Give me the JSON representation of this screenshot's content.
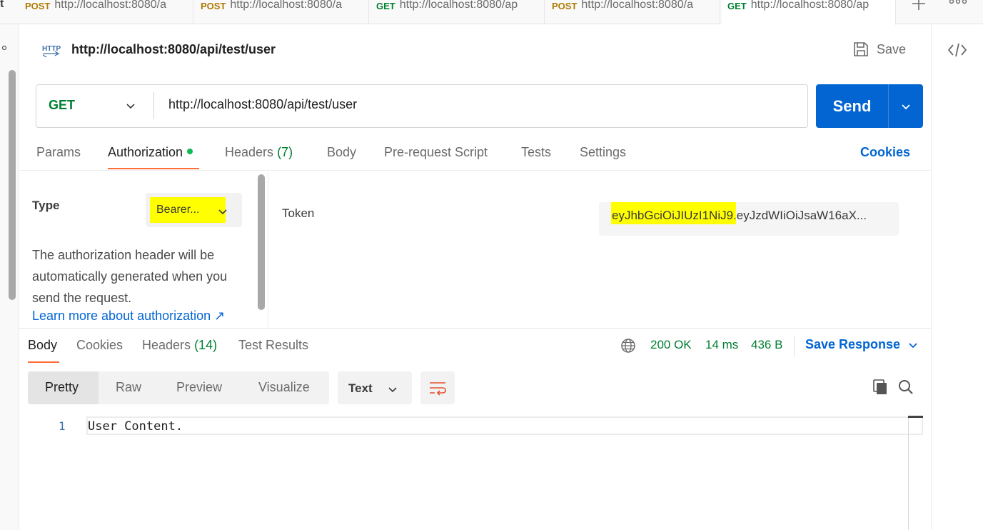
{
  "tabs": [
    {
      "method": "POST",
      "url": "http://localhost:8080/a"
    },
    {
      "method": "POST",
      "url": "http://localhost:8080/a"
    },
    {
      "method": "GET",
      "url": "http://localhost:8080/ap"
    },
    {
      "method": "POST",
      "url": "http://localhost:8080/a"
    },
    {
      "method": "GET",
      "url": "http://localhost:8080/ap"
    }
  ],
  "left_fragment": "t",
  "header": {
    "icon": "HTTP",
    "title": "http://localhost:8080/api/test/user",
    "save_label": "Save"
  },
  "request": {
    "method": "GET",
    "url": "http://localhost:8080/api/test/user",
    "send_label": "Send"
  },
  "request_tabs": {
    "params": "Params",
    "authorization": "Authorization",
    "headers": "Headers",
    "headers_count": "(7)",
    "body": "Body",
    "prerequest": "Pre-request Script",
    "tests": "Tests",
    "settings": "Settings",
    "cookies": "Cookies"
  },
  "auth": {
    "type_label": "Type",
    "type_value": "Bearer...",
    "description": "The authorization header will be automatically generated when you send the request.",
    "learn_more": "Learn more about authorization ↗",
    "token_label": "Token",
    "token_value": "eyJhbGciOiJIUzI1NiJ9.eyJzdWIiOiJsaW16aX..."
  },
  "response_tabs": {
    "body": "Body",
    "cookies": "Cookies",
    "headers": "Headers",
    "headers_count": "(14)",
    "test_results": "Test Results"
  },
  "status": {
    "code": "200 OK",
    "time": "14 ms",
    "size": "436 B",
    "save_response": "Save Response"
  },
  "viewer": {
    "pretty": "Pretty",
    "raw": "Raw",
    "preview": "Preview",
    "visualize": "Visualize",
    "format": "Text"
  },
  "code": [
    {
      "line": "1",
      "text": "User Content."
    }
  ],
  "colors": {
    "accent": "#ff6c37",
    "primary": "#0265d2",
    "success": "#007f31",
    "post": "#ad7a03",
    "highlight": "#ffff00"
  }
}
